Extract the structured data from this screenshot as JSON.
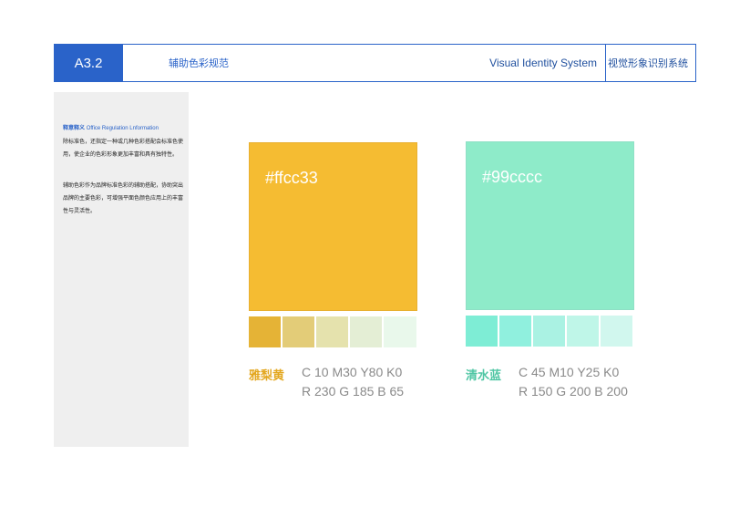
{
  "header": {
    "code": "A3.2",
    "title": "辅助色彩规范",
    "title_en": "Visual Identity System",
    "title_cn": "视觉形象识别系统"
  },
  "sidebar": {
    "heading_cn": "释意释义",
    "heading_en": "Office Regulation Lnformation",
    "paragraphs": [
      "除标准色，还指定一种或几种色彩搭配会标准色使用，使企业的色彩形象更加丰富和具有独特性。",
      "辅助色彩作为品牌标准色彩的辅助搭配，协助突出品牌的主要色彩，可增强平面色颜色应用上的丰富性与灵活性。"
    ]
  },
  "swatches": [
    {
      "hex": "#ffcc33",
      "name": "雅梨黄",
      "cmyk": "C 10  M30  Y80  K0",
      "rgb": "R 230  G 185  B 65",
      "main_color": "#f5bc32",
      "name_color": "#e3a71f",
      "tints": [
        "#e5b336",
        "#e3cc78",
        "#e5e2ad",
        "#e4eed5",
        "#e9f8eb"
      ]
    },
    {
      "hex": "#99cccc",
      "name": "清水蓝",
      "cmyk": "C 45  M10  Y25  K0",
      "rgb": "R 150  G 200  B 200",
      "main_color": "#8eebc9",
      "name_color": "#4fc6a4",
      "tints": [
        "#7eedd5",
        "#90f0de",
        "#aaf2e3",
        "#bff6e8",
        "#d1f7ee"
      ]
    }
  ]
}
